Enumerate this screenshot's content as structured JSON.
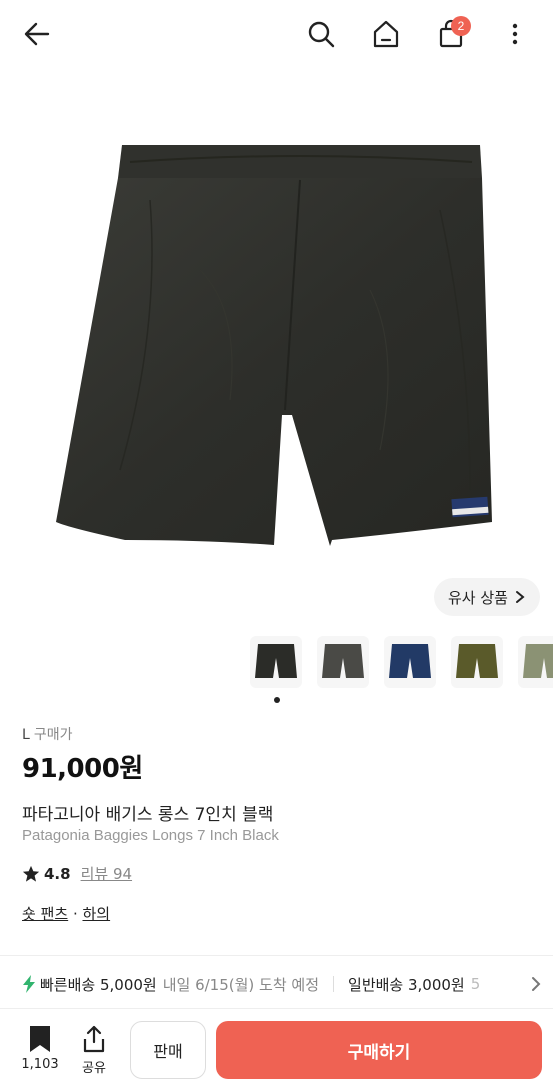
{
  "header": {
    "cart_count": "2",
    "icons": [
      "back-arrow-icon",
      "search-icon",
      "home-icon",
      "shopping-bag-icon",
      "more-vertical-icon"
    ]
  },
  "colors": {
    "accent": "#ef6253",
    "badge": "#ef6253",
    "lightning": "#31b46e",
    "product": "#2f302c"
  },
  "gallery": {
    "similar_label": "유사 상품",
    "thumbnails": [
      "black",
      "charcoal",
      "navy",
      "olive",
      "sage"
    ],
    "thumb_colors": [
      "#2b2c28",
      "#4a4a46",
      "#223a66",
      "#5a5a2a",
      "#8b9274"
    ],
    "selected_index": 0
  },
  "product": {
    "size": "L",
    "price_label": "구매가",
    "price": "91,000원",
    "title_ko": "파타고니아 배기스 롱스 7인치 블랙",
    "title_en": "Patagonia Baggies Longs 7 Inch Black",
    "rating": "4.8",
    "reviews": "리뷰 94",
    "category_main": "숏 팬츠",
    "category_sep": " · ",
    "category_sub": "하의"
  },
  "shipping": {
    "fast_label": "빠른배송 5,000원",
    "fast_eta": "내일 6/15(월) 도착 예정",
    "normal_label": "일반배송 3,000원",
    "normal_cut": "5"
  },
  "bottom": {
    "bookmark_count": "1,103",
    "share_label": "공유",
    "sell_label": "판매",
    "buy_label": "구매하기"
  }
}
